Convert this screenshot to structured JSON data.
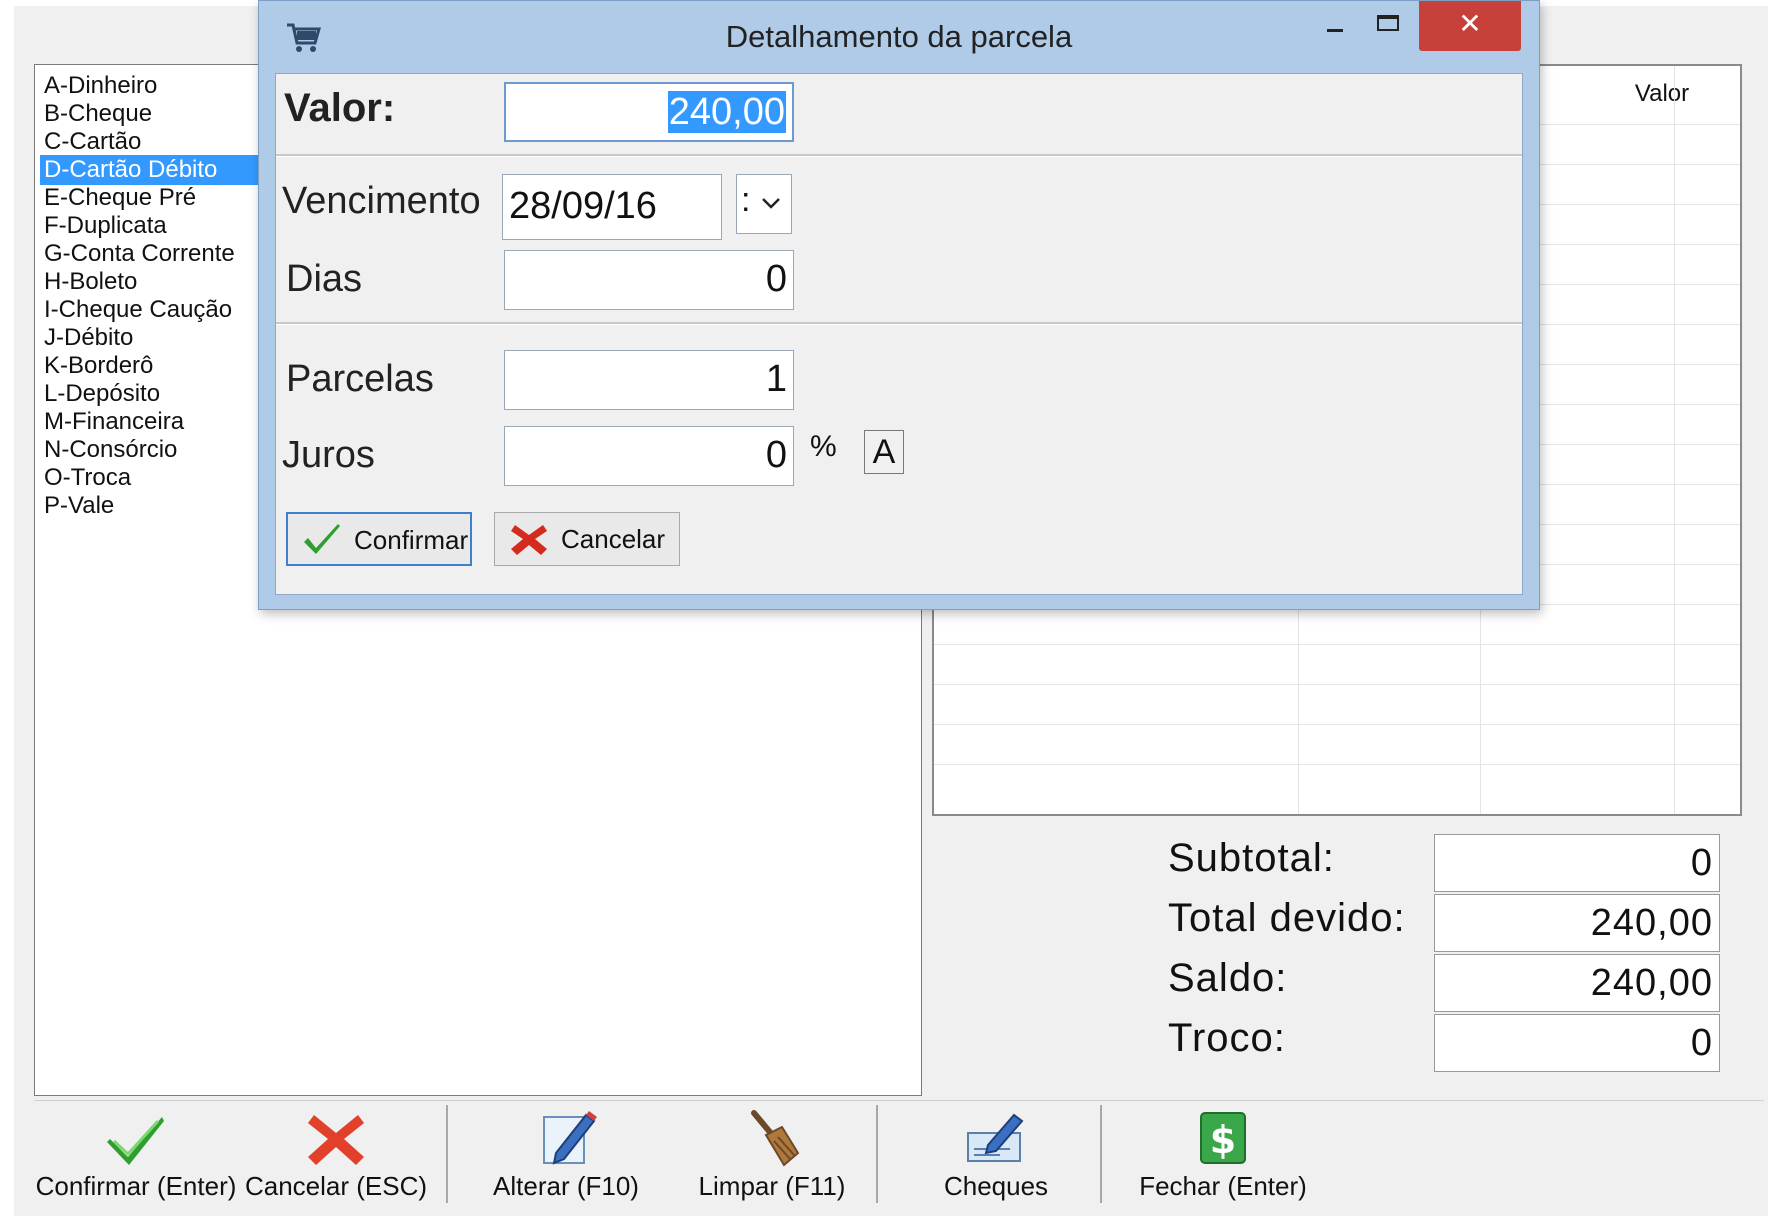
{
  "payment_methods": [
    "A-Dinheiro",
    "B-Cheque",
    "C-Cartão",
    "D-Cartão Débito",
    "E-Cheque Pré",
    "F-Duplicata",
    "G-Conta Corrente",
    "H-Boleto",
    "I-Cheque Caução",
    "J-Débito",
    "K-Borderô",
    "L-Depósito",
    "M-Financeira",
    "N-Consórcio",
    "O-Troca",
    "P-Vale"
  ],
  "selected_payment_index": 3,
  "grid": {
    "column_valor": "Valor"
  },
  "totals": {
    "subtotal_label": "Subtotal:",
    "subtotal_value": "0",
    "total_devido_label": "Total devido:",
    "total_devido_value": "240,00",
    "saldo_label": "Saldo:",
    "saldo_value": "240,00",
    "troco_label": "Troco:",
    "troco_value": "0"
  },
  "toolbar": {
    "confirm": "Confirmar (Enter)",
    "cancel": "Cancelar (ESC)",
    "alter": "Alterar (F10)",
    "clear": "Limpar (F11)",
    "cheques": "Cheques",
    "close": "Fechar (Enter)"
  },
  "dialog": {
    "title": "Detalhamento da parcela",
    "close_glyph": "✕",
    "valor_label": "Valor:",
    "valor_value": "240,00",
    "vencimento_label": "Vencimento",
    "vencimento_value": "28/09/16",
    "vencimento_dropdown_value": ":",
    "dias_label": "Dias",
    "dias_value": "0",
    "parcelas_label": "Parcelas",
    "parcelas_value": "1",
    "juros_label": "Juros",
    "juros_value": "0",
    "percent_symbol": "%",
    "a_button": "A",
    "confirm_button": "Confirmar",
    "cancel_button": "Cancelar"
  },
  "colors": {
    "selection": "#3399ff",
    "dialog_frame": "#afcbe8",
    "close_button": "#c7413a",
    "confirm_green": "#2e9e2e",
    "cancel_red": "#d42b1e"
  }
}
